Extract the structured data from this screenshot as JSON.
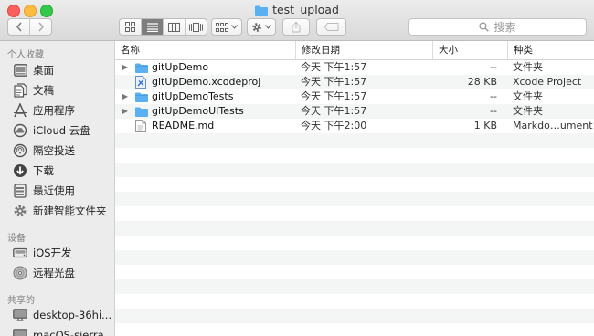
{
  "window": {
    "title": "test_upload"
  },
  "toolbar": {
    "back_icon": "chevron-left-icon",
    "forward_icon": "chevron-right-icon",
    "view_modes": [
      "icon-view",
      "list-view",
      "column-view",
      "cover-flow-view"
    ],
    "active_view": "list-view",
    "search_placeholder": "搜索"
  },
  "sidebar": {
    "favorites_title": "个人收藏",
    "favorites": [
      {
        "label": "桌面",
        "icon": "desktop-icon"
      },
      {
        "label": "文稿",
        "icon": "documents-icon"
      },
      {
        "label": "应用程序",
        "icon": "applications-icon"
      },
      {
        "label": "iCloud 云盘",
        "icon": "icloud-icon"
      },
      {
        "label": "隔空投送",
        "icon": "airdrop-icon"
      },
      {
        "label": "下载",
        "icon": "downloads-icon"
      },
      {
        "label": "最近使用",
        "icon": "recents-icon"
      },
      {
        "label": "新建智能文件夹",
        "icon": "smart-folder-icon"
      }
    ],
    "devices_title": "设备",
    "devices": [
      {
        "label": "iOS开发",
        "icon": "disk-icon"
      },
      {
        "label": "远程光盘",
        "icon": "optical-disc-icon"
      }
    ],
    "shared_title": "共享的",
    "shared": [
      {
        "label": "desktop-36hi...",
        "icon": "monitor-icon"
      },
      {
        "label": "macOS-sierra...",
        "icon": "monitor-icon"
      }
    ]
  },
  "list": {
    "columns": {
      "name": "名称",
      "date": "修改日期",
      "size": "大小",
      "kind": "种类"
    },
    "rows": [
      {
        "name": "gitUpDemo",
        "date": "今天 下午1:57",
        "size": "--",
        "kind": "文件夹",
        "icon": "folder-icon",
        "expandable": true
      },
      {
        "name": "gitUpDemo.xcodeproj",
        "date": "今天 下午1:57",
        "size": "28 KB",
        "kind": "Xcode Project",
        "icon": "xcode-project-icon",
        "expandable": false
      },
      {
        "name": "gitUpDemoTests",
        "date": "今天 下午1:57",
        "size": "--",
        "kind": "文件夹",
        "icon": "folder-icon",
        "expandable": true
      },
      {
        "name": "gitUpDemoUITests",
        "date": "今天 下午1:57",
        "size": "--",
        "kind": "文件夹",
        "icon": "folder-icon",
        "expandable": true
      },
      {
        "name": "README.md",
        "date": "今天 下午2:00",
        "size": "1 KB",
        "kind": "Markdo…ument",
        "icon": "markdown-file-icon",
        "expandable": false
      }
    ],
    "expand_glyph": "▶"
  },
  "colors": {
    "folder": "#5ab0f0",
    "sidebar_bg": "#ececec",
    "stripe": "#f4f5f5"
  }
}
